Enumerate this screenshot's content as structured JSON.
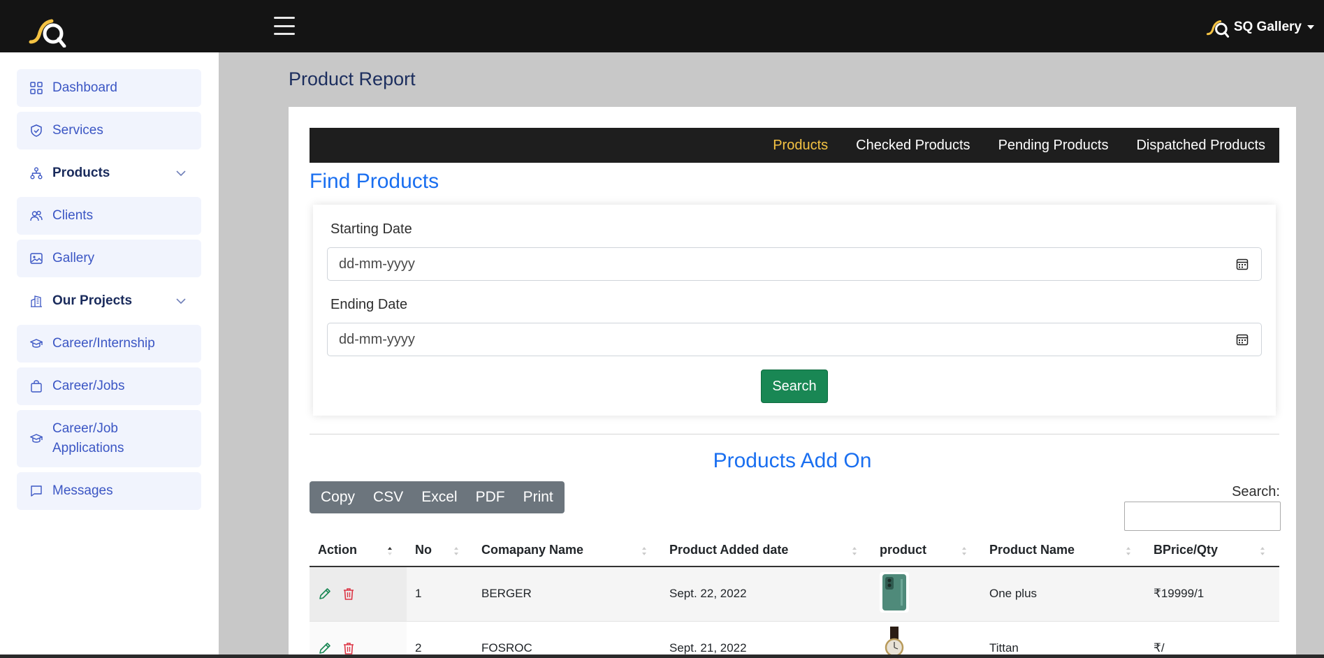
{
  "header": {
    "user_name": "SQ Gallery",
    "menu_icon": "hamburger-menu-icon"
  },
  "sidebar": {
    "items": [
      {
        "label": "Dashboard",
        "icon": "grid-icon"
      },
      {
        "label": "Services",
        "icon": "shield-icon"
      },
      {
        "label": "Products",
        "icon": "sitemap-icon",
        "expandable": true
      },
      {
        "label": "Clients",
        "icon": "users-icon"
      },
      {
        "label": "Gallery",
        "icon": "image-icon"
      },
      {
        "label": "Our Projects",
        "icon": "building-icon",
        "expandable": true
      },
      {
        "label": "Career/Internship",
        "icon": "graduation-cap-icon"
      },
      {
        "label": "Career/Jobs",
        "icon": "briefcase-icon"
      },
      {
        "label": "Career/Job Applications",
        "icon": "graduation-cap-icon"
      },
      {
        "label": "Messages",
        "icon": "chat-icon"
      }
    ]
  },
  "page": {
    "title": "Product Report"
  },
  "tabs": [
    {
      "label": "Products",
      "active": true
    },
    {
      "label": "Checked Products",
      "active": false
    },
    {
      "label": "Pending Products",
      "active": false
    },
    {
      "label": "Dispatched Products",
      "active": false
    }
  ],
  "find": {
    "title": "Find Products",
    "start_label": "Starting Date",
    "start_value": "dd-mm-yyyy",
    "end_label": "Ending Date",
    "end_value": "dd-mm-yyyy",
    "search_button": "Search"
  },
  "addon": {
    "title": "Products Add On",
    "export_buttons": [
      "Copy",
      "CSV",
      "Excel",
      "PDF",
      "Print"
    ],
    "search_label": "Search:",
    "search_value": ""
  },
  "table": {
    "columns": [
      "Action",
      "No",
      "Comapany Name",
      "Product Added date",
      "product",
      "Product Name",
      "BPrice/Qty"
    ],
    "rows": [
      {
        "no": "1",
        "company": "BERGER",
        "date": "Sept. 22, 2022",
        "product_image": "phone-image",
        "name": "One plus",
        "price": "₹19999/1"
      },
      {
        "no": "2",
        "company": "FOSROC",
        "date": "Sept. 21, 2022",
        "product_image": "watch-image",
        "name": "Tittan",
        "price": "₹/"
      }
    ]
  },
  "colors": {
    "topbar": "#141414",
    "accent_blue": "#1a6ff0",
    "active_tab": "#f5c343",
    "search_button": "#198754",
    "export_group": "#6c757d",
    "sidebar_link": "#3b56c4"
  }
}
